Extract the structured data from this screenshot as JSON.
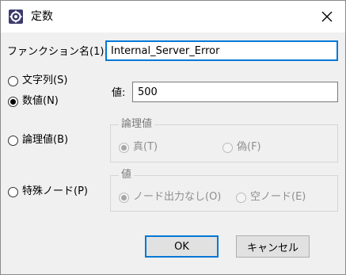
{
  "dialog": {
    "title": "定数",
    "close_glyph": "✕"
  },
  "function_name": {
    "label": "ファンクション名(1):",
    "value": "Internal_Server_Error"
  },
  "type_options": [
    {
      "label": "文字列(S)",
      "selected": false
    },
    {
      "label": "数値(N)",
      "selected": true
    },
    {
      "label": "論理値(B)",
      "selected": false
    },
    {
      "label": "特殊ノード(P)",
      "selected": false
    }
  ],
  "value_field": {
    "label": "値:",
    "value": "500"
  },
  "logical_group": {
    "title": "論理値",
    "options": [
      {
        "label": "真(T)",
        "selected": true,
        "enabled": false
      },
      {
        "label": "偽(F)",
        "selected": false,
        "enabled": false
      }
    ]
  },
  "special_group": {
    "title": "値",
    "options": [
      {
        "label": "ノード出力なし(O)",
        "selected": true,
        "enabled": false
      },
      {
        "label": "空ノード(E)",
        "selected": false,
        "enabled": false
      }
    ]
  },
  "buttons": {
    "ok": "OK",
    "cancel": "キャンセル"
  },
  "colors": {
    "accent": "#0078d7",
    "background": "#f0f0f0",
    "disabled_text": "#8f8f8f"
  },
  "icons": {
    "app": "gear-icon",
    "close": "close-icon"
  }
}
